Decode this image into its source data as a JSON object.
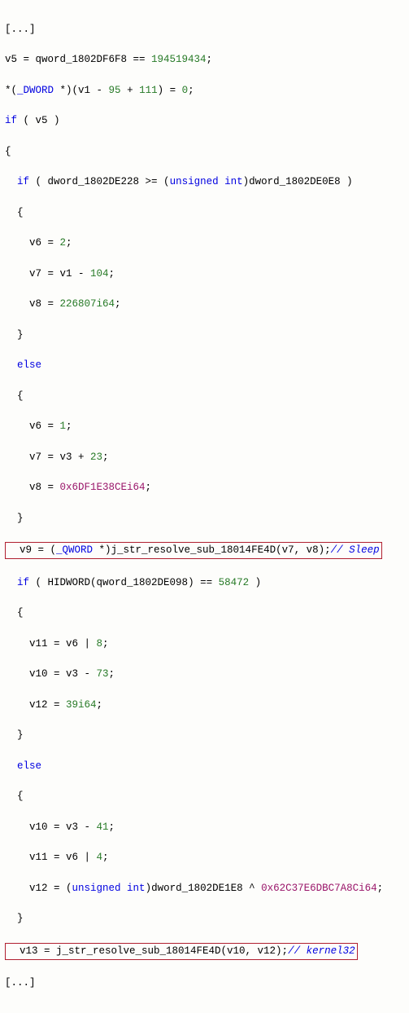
{
  "lines": {
    "l0": "[...]",
    "l1a": "v5 = qword_1802DF6F8 == ",
    "l1b": "194519434",
    "l1c": ";",
    "l2a": "*(",
    "l2b": "_DWORD",
    "l2c": " *)(v1 - ",
    "l2d": "95",
    "l2e": " + ",
    "l2f": "111",
    "l2g": ") = ",
    "l2h": "0",
    "l2i": ";",
    "l3a": "if",
    "l3b": " ( v5 )",
    "l4": "{",
    "l5a": "  ",
    "l5b": "if",
    "l5c": " ( dword_1802DE228 >= (",
    "l5d": "unsigned",
    "l5e": " ",
    "l5f": "int",
    "l5g": ")dword_1802DE0E8 )",
    "l6": "  {",
    "l7a": "    v6 = ",
    "l7b": "2",
    "l7c": ";",
    "l8a": "    v7 = v1 - ",
    "l8b": "104",
    "l8c": ";",
    "l9a": "    v8 = ",
    "l9b": "226807i64",
    "l9c": ";",
    "l10": "  }",
    "l11a": "  ",
    "l11b": "else",
    "l12": "  {",
    "l13a": "    v6 = ",
    "l13b": "1",
    "l13c": ";",
    "l14a": "    v7 = v3 + ",
    "l14b": "23",
    "l14c": ";",
    "l15a": "    v8 = ",
    "l15b": "0x6DF1E38CEi64",
    "l15c": ";",
    "l16": "  }",
    "l17a": "  v9 = (",
    "l17b": "_QWORD",
    "l17c": " *)j_str_resolve_sub_18014FE4D(v7, v8);",
    "l17d": "// Sleep",
    "l18a": "  ",
    "l18b": "if",
    "l18c": " ( HIDWORD(qword_1802DE098) == ",
    "l18d": "58472",
    "l18e": " )",
    "l19": "  {",
    "l20a": "    v11 = v6 | ",
    "l20b": "8",
    "l20c": ";",
    "l21a": "    v10 = v3 - ",
    "l21b": "73",
    "l21c": ";",
    "l22a": "    v12 = ",
    "l22b": "39i64",
    "l22c": ";",
    "l23": "  }",
    "l24a": "  ",
    "l24b": "else",
    "l25": "  {",
    "l26a": "    v10 = v3 - ",
    "l26b": "41",
    "l26c": ";",
    "l27a": "    v11 = v6 | ",
    "l27b": "4",
    "l27c": ";",
    "l28a": "    v12 = (",
    "l28b": "unsigned",
    "l28c": " ",
    "l28d": "int",
    "l28e": ")dword_1802DE1E8 ^ ",
    "l28f": "0x62C37E6DBC7A8Ci64",
    "l28g": ";",
    "l29": "  }",
    "l30a": "  v13 = j_str_resolve_sub_18014FE4D(v10, v12);",
    "l30b": "// kernel32",
    "l31": "[...]"
  }
}
